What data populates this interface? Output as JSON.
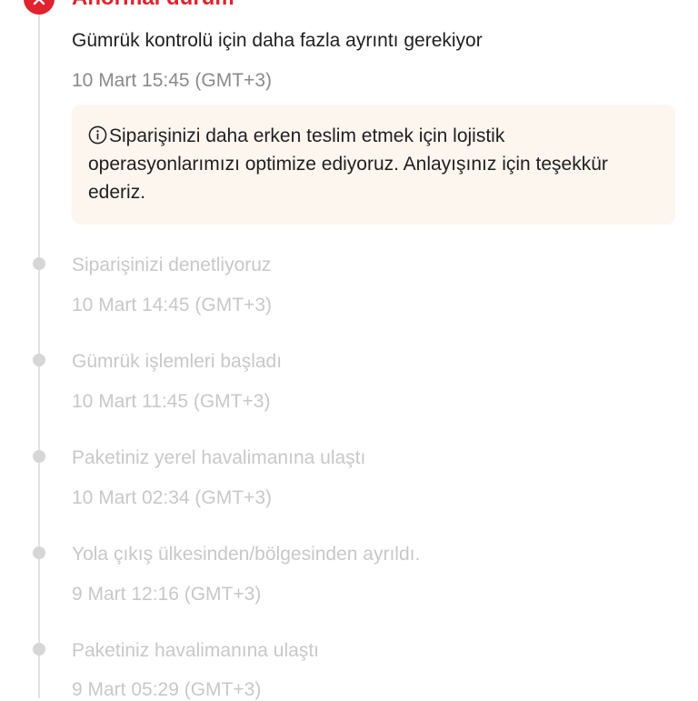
{
  "current": {
    "status": "Anormal durum",
    "title": "Gümrük kontrolü için daha fazla ayrıntı gerekiyor",
    "time": "10 Mart 15:45 (GMT+3)",
    "notice": "Siparişinizi daha erken teslim etmek için lojistik operasyonlarımızı optimize ediyoruz. Anlayışınız için teşekkür ederiz.",
    "status_color": "#e0232e",
    "notice_background": "#fdf6ef"
  },
  "events": [
    {
      "title": "Siparişinizi denetliyoruz",
      "time": "10 Mart 14:45 (GMT+3)"
    },
    {
      "title": "Gümrük işlemleri başladı",
      "time": "10 Mart 11:45 (GMT+3)"
    },
    {
      "title": "Paketiniz yerel havalimanına ulaştı",
      "time": "10 Mart 02:34 (GMT+3)"
    },
    {
      "title": "Yola çıkış ülkesinden/bölgesinden ayrıldı.",
      "time": "9 Mart 12:16 (GMT+3)"
    },
    {
      "title": "Paketiniz havalimanına ulaştı",
      "time": "9 Mart 05:29 (GMT+3)"
    }
  ],
  "icons": {
    "status": "close-circle-icon",
    "notice": "info-circle-icon",
    "event_marker": "timeline-dot"
  }
}
